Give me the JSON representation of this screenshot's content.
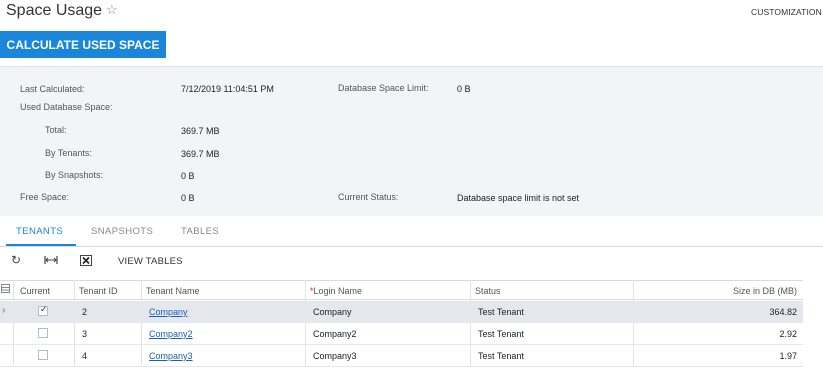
{
  "header": {
    "title": "Space Usage",
    "star_icon": "star-outline-icon",
    "customization": "CUSTOMIZATION"
  },
  "actions": {
    "calculate_label": "CALCULATE USED SPACE"
  },
  "summary": {
    "last_calculated_label": "Last Calculated:",
    "last_calculated_value": "7/12/2019 11:04:51 PM",
    "db_space_limit_label": "Database Space Limit:",
    "db_space_limit_value": "0 B",
    "used_db_space_label": "Used Database Space:",
    "total_label": "Total:",
    "total_value": "369.7 MB",
    "by_tenants_label": "By Tenants:",
    "by_tenants_value": "369.7 MB",
    "by_snapshots_label": "By Snapshots:",
    "by_snapshots_value": "0 B",
    "free_space_label": "Free Space:",
    "free_space_value": "0 B",
    "current_status_label": "Current Status:",
    "current_status_value": "Database space limit is not set"
  },
  "tabs": [
    {
      "label": "TENANTS",
      "active": true
    },
    {
      "label": "SNAPSHOTS",
      "active": false
    },
    {
      "label": "TABLES",
      "active": false
    }
  ],
  "toolbar": {
    "refresh_icon": "refresh-icon",
    "fit_icon": "fit-columns-icon",
    "export_icon": "export-excel-icon",
    "view_tables_label": "VIEW TABLES"
  },
  "grid": {
    "columns": {
      "current": "Current",
      "tenant_id": "Tenant ID",
      "tenant_name": "Tenant Name",
      "login_name": "Login Name",
      "status": "Status",
      "size": "Size in DB (MB)"
    },
    "required_marker": "*",
    "rows": [
      {
        "current": true,
        "tenant_id": "2",
        "tenant_name": "Company",
        "login_name": "Company",
        "status": "Test Tenant",
        "size": "364.82"
      },
      {
        "current": false,
        "tenant_id": "3",
        "tenant_name": "Company2",
        "login_name": "Company2",
        "status": "Test Tenant",
        "size": "2.92"
      },
      {
        "current": false,
        "tenant_id": "4",
        "tenant_name": "Company3",
        "login_name": "Company3",
        "status": "Test Tenant",
        "size": "1.97"
      }
    ]
  },
  "colors": {
    "accent": "#1a86d9",
    "link": "#1a5fb4",
    "summary_bg": "#f2f4f7"
  }
}
